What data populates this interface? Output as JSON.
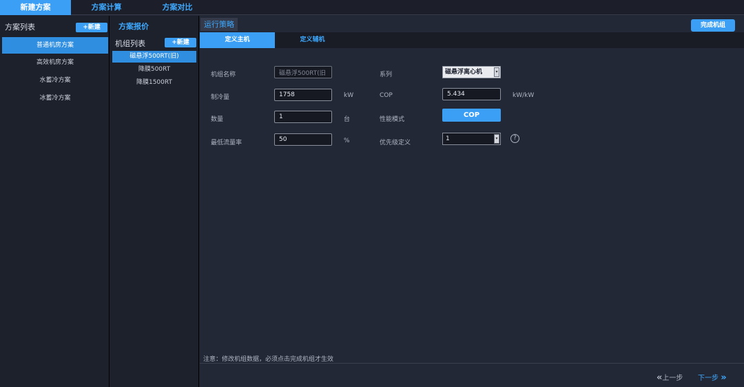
{
  "topnav": {
    "tabs": [
      "新建方案",
      "方案计算",
      "方案对比"
    ]
  },
  "plan_list": {
    "title": "方案列表",
    "new_label": "+新建",
    "items": [
      "普通机房方案",
      "高效机房方案",
      "水蓄冷方案",
      "冰蓄冷方案"
    ]
  },
  "header_tabs": {
    "quote": "方案报价",
    "strategy": "运行策略",
    "finish": "完成机组"
  },
  "unit_list": {
    "title": "机组列表",
    "new_label": "+新建",
    "items": [
      "磁悬浮500RT(旧)",
      "降膜500RT",
      "降膜1500RT"
    ]
  },
  "subtabs": [
    "定义主机",
    "定义辅机"
  ],
  "form": {
    "name_label": "机组名称",
    "name_value": "磁悬浮500RT(旧",
    "series_label": "系列",
    "series_value": "磁悬浮离心机",
    "capacity_label": "制冷量",
    "capacity_value": "1758",
    "capacity_unit": "kW",
    "cop_label": "COP",
    "cop_value": "5.434",
    "cop_unit": "kW/kW",
    "count_label": "数量",
    "count_value": "1",
    "count_unit": "台",
    "perf_label": "性能模式",
    "perf_button": "COP",
    "flow_label": "最低流量率",
    "flow_value": "50",
    "flow_unit": "%",
    "priority_label": "优先级定义",
    "priority_value": "1",
    "help_glyph": "?"
  },
  "note": "注意：修改机组数据，必须点击完成机组才生效",
  "footer": {
    "prev": "上一步",
    "next": "下一步"
  },
  "colors": {
    "accent": "#3a9ff5",
    "link": "#3ea9ff",
    "background": "#1f2330"
  }
}
